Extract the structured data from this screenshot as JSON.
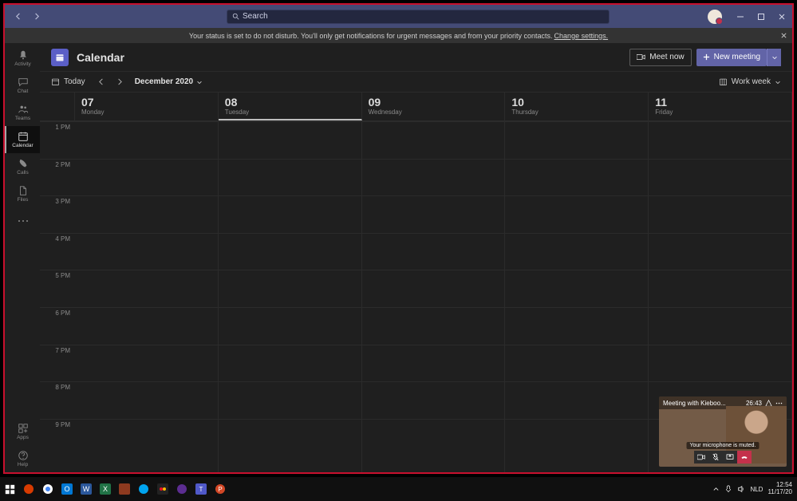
{
  "titlebar": {
    "search_placeholder": "Search"
  },
  "banner": {
    "text": "Your status is set to do not disturb. You'll only get notifications for urgent messages and from your priority contacts.",
    "link": "Change settings."
  },
  "rail": {
    "items": [
      {
        "id": "activity",
        "label": "Activity"
      },
      {
        "id": "chat",
        "label": "Chat"
      },
      {
        "id": "teams",
        "label": "Teams"
      },
      {
        "id": "calendar",
        "label": "Calendar"
      },
      {
        "id": "calls",
        "label": "Calls"
      },
      {
        "id": "files",
        "label": "Files"
      }
    ],
    "apps_label": "Apps",
    "help_label": "Help"
  },
  "header": {
    "title": "Calendar",
    "meet_now": "Meet now",
    "new_meeting": "New meeting"
  },
  "toolbar": {
    "today": "Today",
    "month": "December 2020",
    "view": "Work week"
  },
  "calendar": {
    "days": [
      {
        "num": "07",
        "name": "Monday"
      },
      {
        "num": "08",
        "name": "Tuesday"
      },
      {
        "num": "09",
        "name": "Wednesday"
      },
      {
        "num": "10",
        "name": "Thursday"
      },
      {
        "num": "11",
        "name": "Friday"
      }
    ],
    "today_index": 1,
    "times": [
      "1 PM",
      "2 PM",
      "3 PM",
      "4 PM",
      "5 PM",
      "6 PM",
      "7 PM",
      "8 PM",
      "9 PM"
    ]
  },
  "meeting_overlay": {
    "title": "Meeting with Kieboo...",
    "timer": "26:43",
    "mic_note": "Your microphone is muted."
  },
  "taskbar": {
    "lang": "NLD",
    "time": "12:54",
    "date": "11/17/20"
  }
}
